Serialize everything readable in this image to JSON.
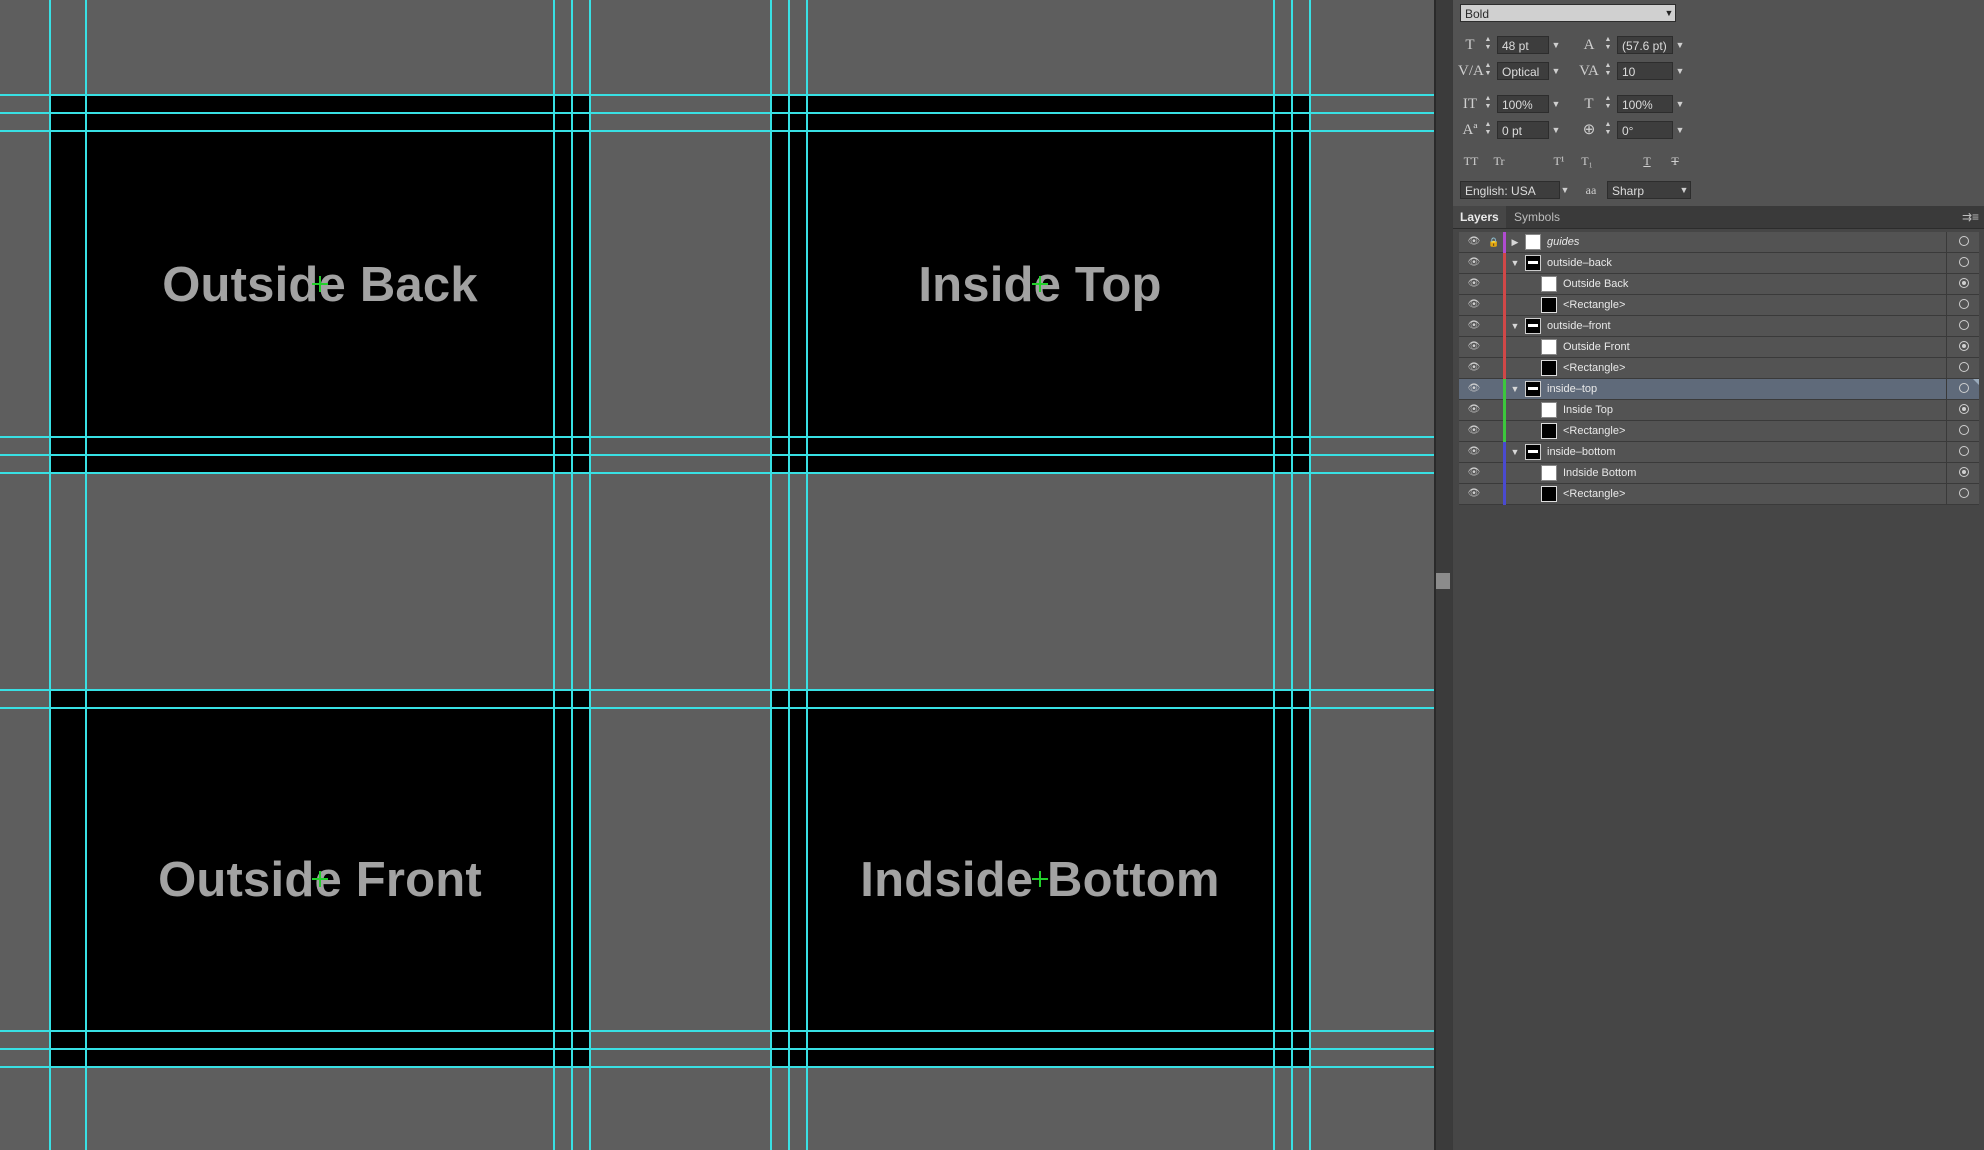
{
  "canvas": {
    "panels": [
      {
        "id": "outside-back",
        "label": "Outside Back"
      },
      {
        "id": "inside-top",
        "label": "Inside Top"
      },
      {
        "id": "outside-front",
        "label": "Outside Front"
      },
      {
        "id": "inside-bottom",
        "label": "Indside Bottom"
      }
    ],
    "guide_color": "#38e0e4",
    "center_marker_color": "#22d02b"
  },
  "character_panel": {
    "font_style": "Bold",
    "font_size": "48 pt",
    "leading": "(57.6 pt)",
    "kerning": "Optical",
    "tracking": "10",
    "vertical_scale": "100%",
    "horizontal_scale": "100%",
    "baseline_shift": "0 pt",
    "rotation": "0°",
    "language": "English: USA",
    "anti_alias_icon": "aa",
    "anti_alias": "Sharp",
    "type_buttons": [
      "TT",
      "Tr",
      "T¹",
      "T₁",
      "T",
      "T"
    ]
  },
  "layers_panel": {
    "tabs": [
      "Layers",
      "Symbols"
    ],
    "menu_icon": "⇉≡",
    "rows": [
      {
        "name": "guides",
        "level": 0,
        "type": "layer",
        "expanded": false,
        "color": "#b04bd0",
        "thumb": "white",
        "target": "empty",
        "selected": false,
        "italic": true
      },
      {
        "name": "outside–back",
        "level": 0,
        "type": "layer",
        "expanded": true,
        "color": "#d04848",
        "thumb": "group",
        "target": "empty",
        "selected": false
      },
      {
        "name": "Outside Back",
        "level": 1,
        "type": "text",
        "color": "#d04848",
        "thumb": "white",
        "target": "filled",
        "selected": false
      },
      {
        "name": "<Rectangle>",
        "level": 1,
        "type": "shape",
        "color": "#d04848",
        "thumb": "black",
        "target": "empty",
        "selected": false
      },
      {
        "name": "outside–front",
        "level": 0,
        "type": "layer",
        "expanded": true,
        "color": "#d04848",
        "thumb": "group",
        "target": "empty",
        "selected": false
      },
      {
        "name": "Outside Front",
        "level": 1,
        "type": "text",
        "color": "#d04848",
        "thumb": "white",
        "target": "filled",
        "selected": false
      },
      {
        "name": "<Rectangle>",
        "level": 1,
        "type": "shape",
        "color": "#d04848",
        "thumb": "black",
        "target": "empty",
        "selected": false
      },
      {
        "name": "inside–top",
        "level": 0,
        "type": "layer",
        "expanded": true,
        "color": "#3cc83c",
        "thumb": "group",
        "target": "empty",
        "selected": true
      },
      {
        "name": "Inside Top",
        "level": 1,
        "type": "text",
        "color": "#3cc83c",
        "thumb": "white",
        "target": "filled",
        "selected": false
      },
      {
        "name": "<Rectangle>",
        "level": 1,
        "type": "shape",
        "color": "#3cc83c",
        "thumb": "black",
        "target": "empty",
        "selected": false
      },
      {
        "name": "inside–bottom",
        "level": 0,
        "type": "layer",
        "expanded": true,
        "color": "#4a4ad0",
        "thumb": "group",
        "target": "empty",
        "selected": false
      },
      {
        "name": "Indside Bottom",
        "level": 1,
        "type": "text",
        "color": "#4a4ad0",
        "thumb": "white",
        "target": "filled",
        "selected": false
      },
      {
        "name": "<Rectangle>",
        "level": 1,
        "type": "shape",
        "color": "#4a4ad0",
        "thumb": "black",
        "target": "empty",
        "selected": false
      }
    ]
  }
}
